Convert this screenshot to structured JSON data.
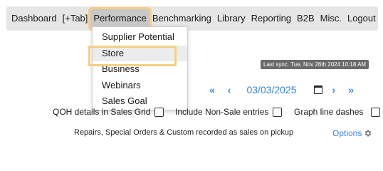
{
  "nav": {
    "items": [
      "Dashboard",
      "[+Tab]",
      "Performance",
      "Benchmarking",
      "Library",
      "Reporting",
      "B2B",
      "Misc.",
      "Logout"
    ],
    "active_index": 2
  },
  "performance_menu": {
    "items": [
      "Supplier Potential",
      "Store",
      "Business",
      "Webinars",
      "Sales Goal"
    ],
    "highlighted_index": 1
  },
  "sync_status": "Last sync. Tue, Nov 26th 2024 10:18 AM",
  "date_nav": {
    "first": "«",
    "prev": "‹",
    "date": "03/03/2025",
    "next": "›",
    "last": "»",
    "calendar_icon": "calendar-icon"
  },
  "options": {
    "qoh": "QOH details in Sales Grid",
    "non_sale": "Include Non-Sale entries",
    "graph_dashes": "Graph line dashes"
  },
  "footer_note": "Repairs, Special Orders & Custom recorded as sales on pickup",
  "options_link": "Options",
  "colors": {
    "highlight": "#f6cf82",
    "link": "#3a86d8",
    "navbar_bg": "#e6e6e6",
    "badge_bg": "#6b6b6b"
  }
}
